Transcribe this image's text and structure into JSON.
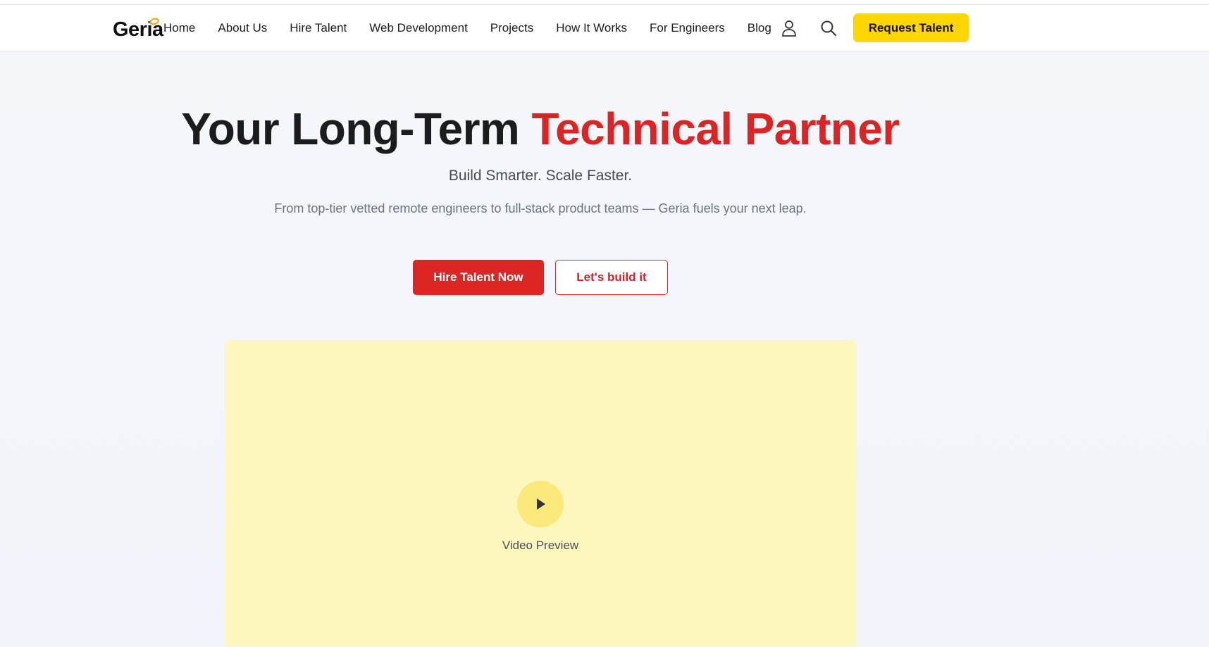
{
  "logo": {
    "text": "Geria"
  },
  "nav": {
    "items": [
      "Home",
      "About Us",
      "Hire Talent",
      "Web Development",
      "Projects",
      "How It Works",
      "For Engineers",
      "Blog"
    ]
  },
  "header": {
    "cta_label": "Request Talent",
    "icons": [
      "user-icon",
      "search-icon"
    ]
  },
  "hero": {
    "title_main": "Your Long-Term ",
    "title_accent": "Technical Partner",
    "tagline": "Build Smarter. Scale Faster.",
    "description": "From top-tier vetted remote engineers to full-stack product teams — Geria fuels your next leap.",
    "primary_button": "Hire Talent Now",
    "secondary_button": "Let's build it"
  },
  "video": {
    "label": "Video Preview",
    "icon": "play-icon"
  },
  "colors": {
    "accent_red": "#dc2525",
    "cta_yellow": "#ffd600",
    "video_bg": "#fdf6bd",
    "play_bg": "#fbe87a"
  }
}
